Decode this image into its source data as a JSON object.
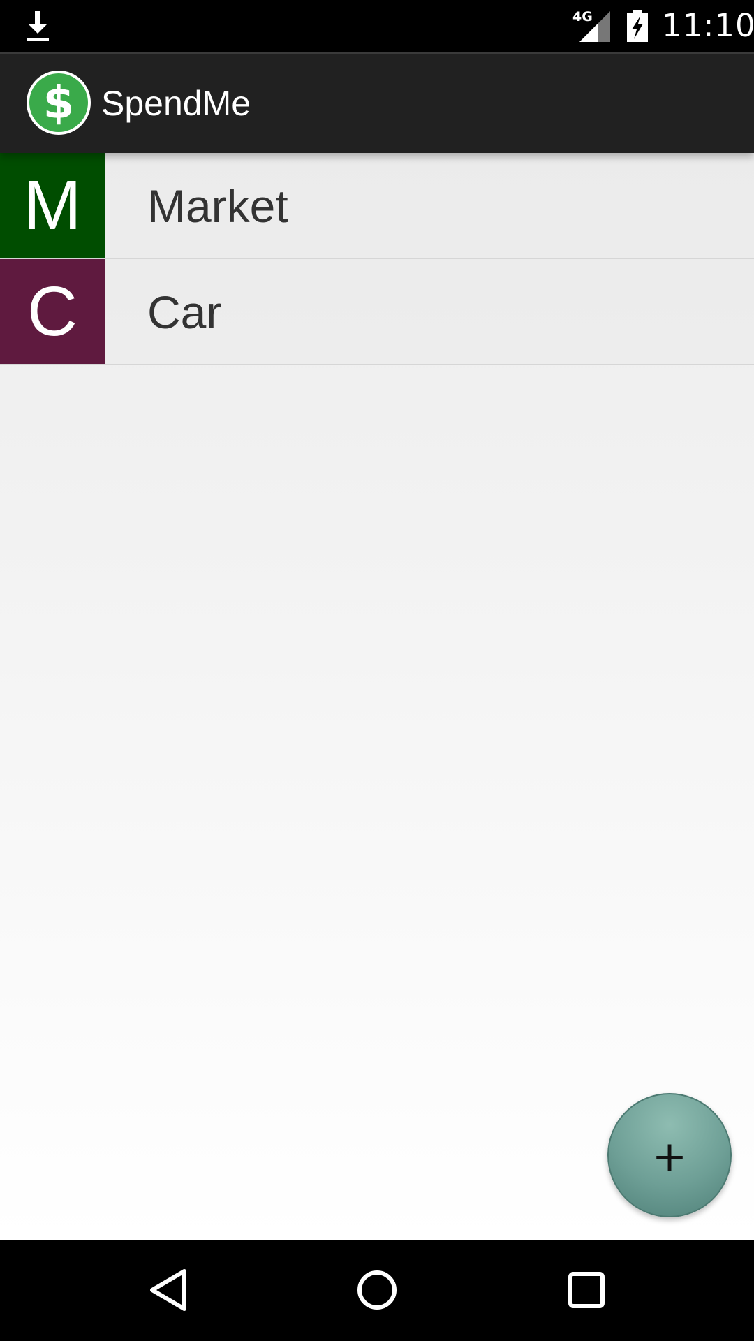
{
  "status_bar": {
    "network_type": "4G",
    "time": "11:10",
    "icons": [
      "download-icon",
      "signal-icon",
      "battery-charging-icon"
    ]
  },
  "action_bar": {
    "app_title": "SpendMe",
    "logo_icon": "dollar-icon",
    "logo_color": "#3aaa4a"
  },
  "categories": [
    {
      "letter": "M",
      "label": "Market",
      "color": "#004d00"
    },
    {
      "letter": "C",
      "label": "Car",
      "color": "#5f1a3f"
    }
  ],
  "fab": {
    "label": "+",
    "color": "#6e9f96"
  },
  "nav_bar": {
    "buttons": [
      "back-icon",
      "home-icon",
      "recents-icon"
    ]
  }
}
